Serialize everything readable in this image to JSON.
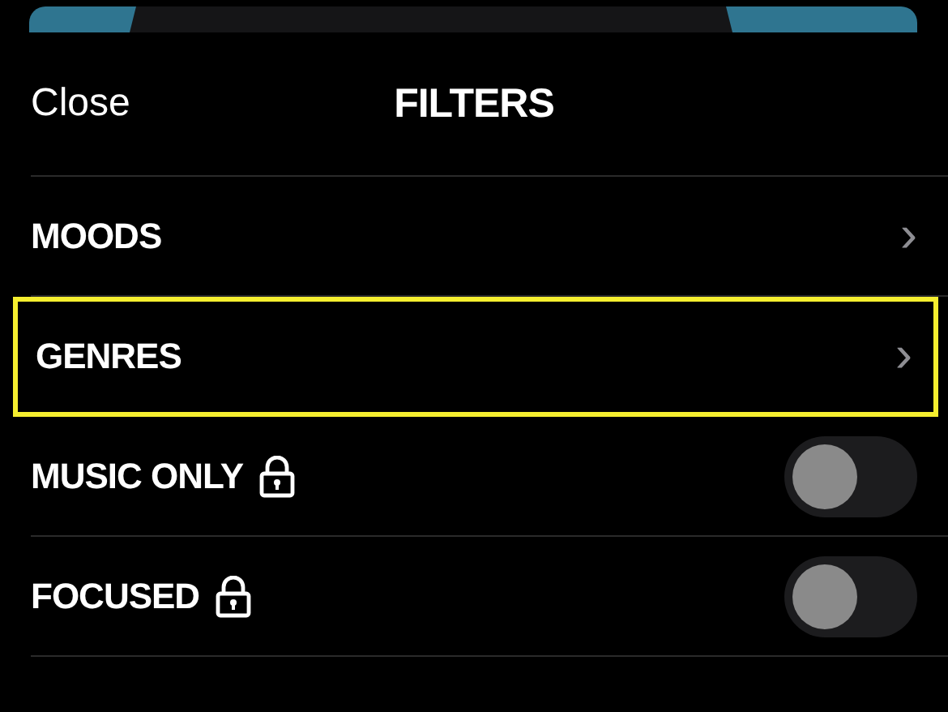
{
  "header": {
    "close": "Close",
    "title": "FILTERS"
  },
  "items": [
    {
      "kind": "nav",
      "label": "MOODS",
      "chevron": "›",
      "highlighted": false
    },
    {
      "kind": "nav",
      "label": "GENRES",
      "chevron": "›",
      "highlighted": true
    },
    {
      "kind": "toggle",
      "label": "MUSIC ONLY",
      "locked": true,
      "on": false
    },
    {
      "kind": "toggle",
      "label": "FOCUSED",
      "locked": true,
      "on": false
    }
  ]
}
